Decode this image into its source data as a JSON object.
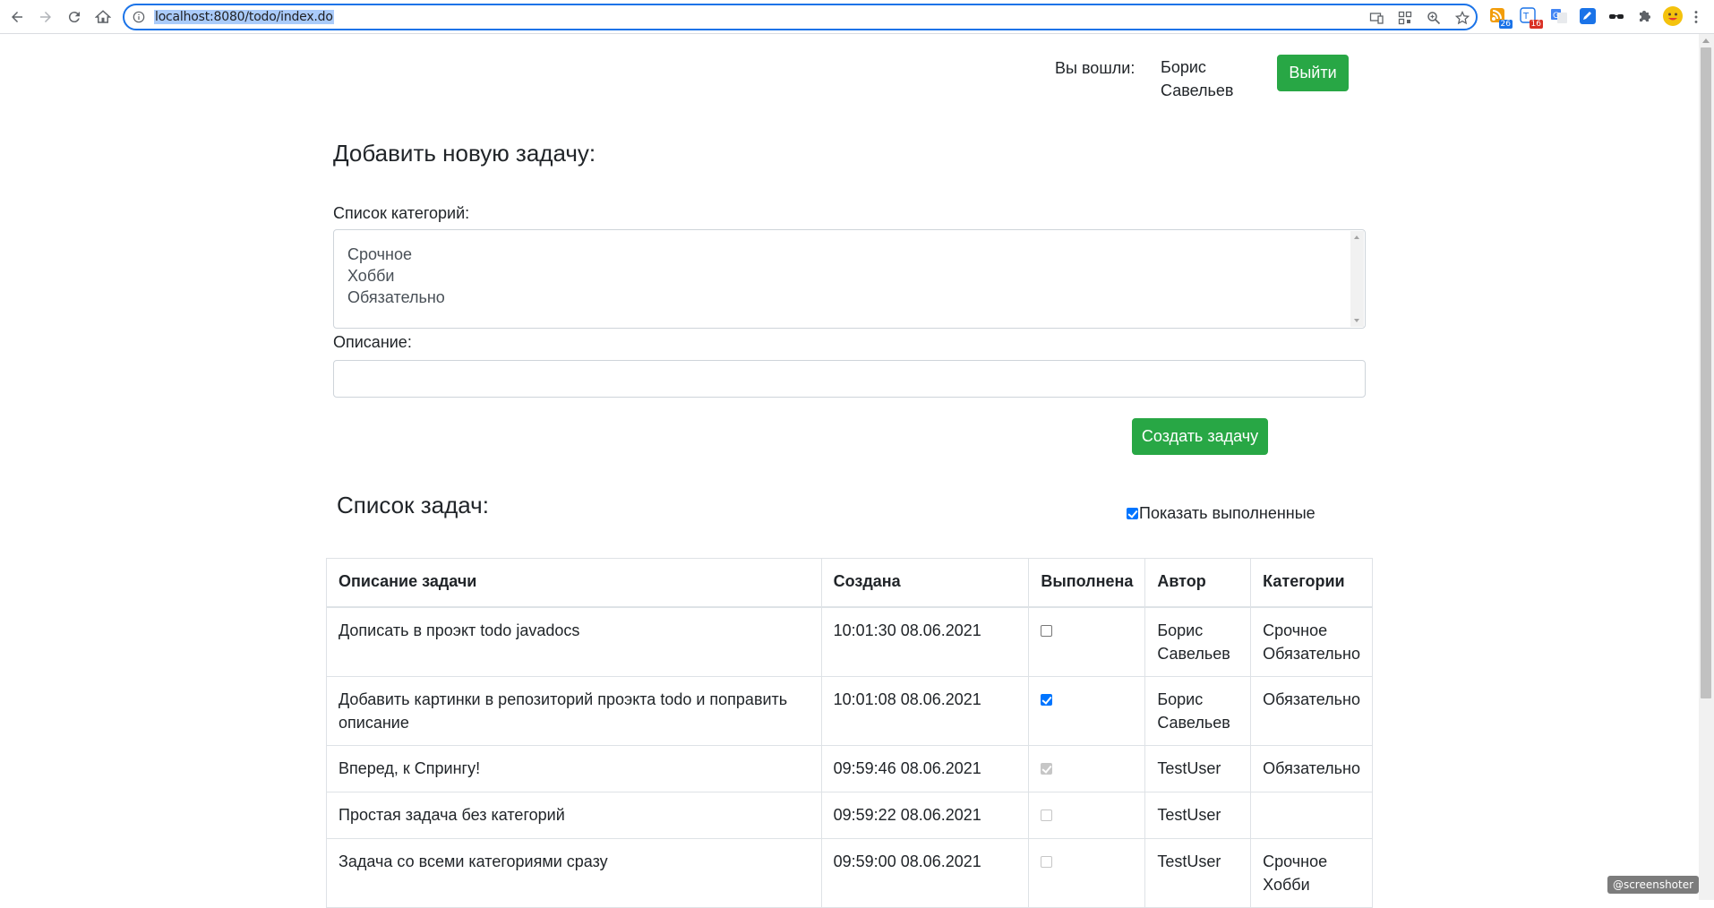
{
  "browser": {
    "url": "localhost:8080/todo/index.do",
    "extension_badges": [
      "26",
      "16"
    ]
  },
  "header": {
    "logged_in_label": "Вы вошли:",
    "user_name": "Борис Савельев",
    "logout_label": "Выйти"
  },
  "add_form": {
    "title": "Добавить новую задачу:",
    "categories_label": "Список категорий:",
    "categories": [
      "Срочное",
      "Хобби",
      "Обязательно"
    ],
    "description_label": "Описание:",
    "description_value": "",
    "create_label": "Создать задачу"
  },
  "task_list": {
    "title": "Список задач:",
    "show_done_label": "Показать выполненные",
    "show_done_checked": true,
    "columns": [
      "Описание задачи",
      "Создана",
      "Выполнена",
      "Автор",
      "Категории"
    ],
    "rows": [
      {
        "description": "Дописать в проэкт todo javadocs",
        "created": "10:01:30 08.06.2021",
        "done": false,
        "editable": true,
        "author": "Борис Савельев",
        "categories": [
          "Срочное",
          "Обязательно"
        ]
      },
      {
        "description": "Добавить картинки в репозиторий проэкта todo и поправить описание",
        "created": "10:01:08 08.06.2021",
        "done": true,
        "editable": true,
        "author": "Борис Савельев",
        "categories": [
          "Обязательно"
        ]
      },
      {
        "description": "Вперед, к Спрингу!",
        "created": "09:59:46 08.06.2021",
        "done": true,
        "editable": false,
        "author": "TestUser",
        "categories": [
          "Обязательно"
        ]
      },
      {
        "description": "Простая задача без категорий",
        "created": "09:59:22 08.06.2021",
        "done": false,
        "editable": false,
        "author": "TestUser",
        "categories": []
      },
      {
        "description": "Задача со всеми категориями сразу",
        "created": "09:59:00 08.06.2021",
        "done": false,
        "editable": false,
        "author": "TestUser",
        "categories": [
          "Срочное",
          "Хобби"
        ]
      }
    ]
  },
  "watermark": "@screenshoter",
  "colors": {
    "accent_green": "#28a745",
    "checkbox_blue": "#0075ff",
    "omnibox_border": "#1a73e8"
  }
}
